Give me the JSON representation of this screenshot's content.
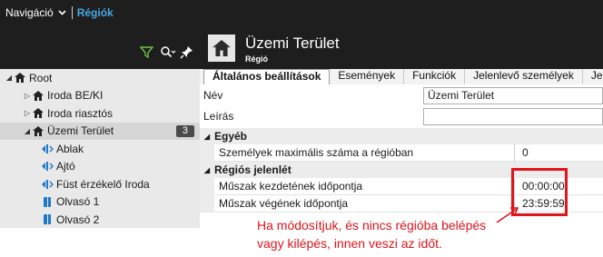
{
  "topbar": {
    "nav_label": "Navigáció",
    "crumb": "Régiók"
  },
  "tree": {
    "items": [
      {
        "label": "Root",
        "arrow": "◢",
        "icon": "home-icon",
        "level": 0
      },
      {
        "label": "Iroda BE/KI",
        "arrow": "▷",
        "icon": "home-icon",
        "level": 1
      },
      {
        "label": "Iroda riasztós",
        "arrow": "▷",
        "icon": "home-icon",
        "level": 1
      },
      {
        "label": "Üzemi Terület",
        "arrow": "◢",
        "icon": "home-icon",
        "level": 1,
        "badge": "3"
      },
      {
        "label": "Ablak",
        "icon": "door-icon",
        "level": 2
      },
      {
        "label": "Ajtó",
        "icon": "door-icon",
        "level": 2
      },
      {
        "label": "Füst érzékelő Iroda",
        "icon": "door-icon",
        "level": 2
      },
      {
        "label": "Olvasó 1",
        "icon": "reader-icon",
        "level": 2
      },
      {
        "label": "Olvasó 2",
        "icon": "reader-icon",
        "level": 2
      }
    ]
  },
  "header": {
    "title": "Üzemi Terület",
    "subtitle": "Régió"
  },
  "tabs": [
    "Általános beállítások",
    "Események",
    "Funkciók",
    "Jelenlevő személyek",
    "Jelenlét"
  ],
  "props": {
    "name_label": "Név",
    "name_value": "Üzemi Terület",
    "desc_label": "Leírás",
    "desc_value": "",
    "section1": "Egyéb",
    "max_label": "Személyek maximális száma a régióban",
    "max_value": "0",
    "section2": "Régiós jelenlét",
    "start_label": "Műszak kezdetének időpontja",
    "start_value": "00:00:00",
    "end_label": "Műszak végének időpontja",
    "end_value": "23:59:59"
  },
  "annotation": {
    "line1": "Ha módosítjuk, és nincs régióba belépés",
    "line2": "vagy kilépés, innen veszi az időt."
  },
  "colors": {
    "accent": "#49a8e6",
    "annotation": "#e0141b",
    "door_icon": "#1f78c8"
  }
}
